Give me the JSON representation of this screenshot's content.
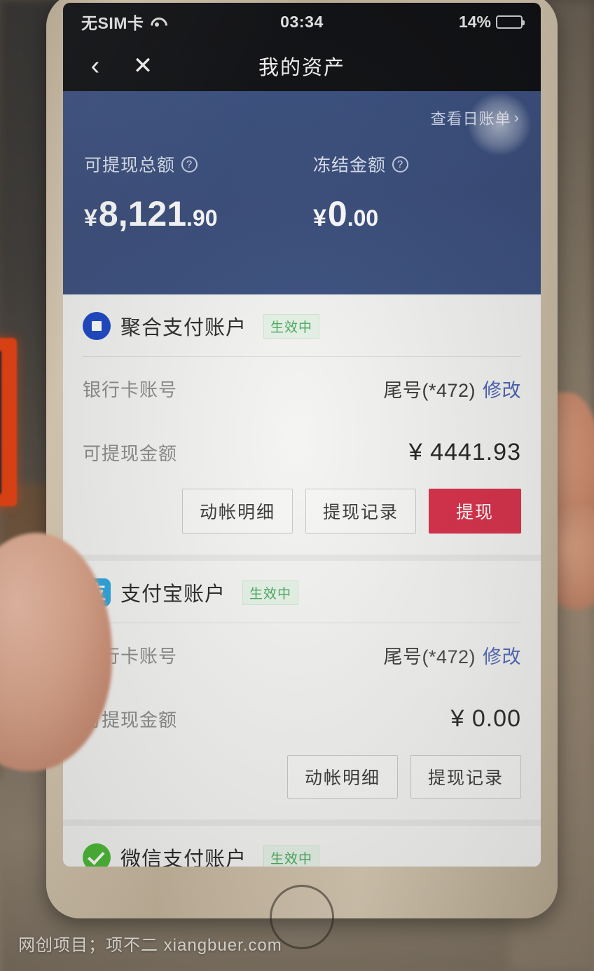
{
  "status_bar": {
    "carrier": "无SIM卡",
    "wifi_icon": "wifi-icon",
    "time": "03:34",
    "battery_percent": "14%",
    "battery_level": 14
  },
  "nav_bar": {
    "back_icon": "‹",
    "close_icon": "✕",
    "title": "我的资产"
  },
  "summary": {
    "daily_bill_link": "查看日账单",
    "chevron": "›",
    "withdrawable_total": {
      "label": "可提现总额",
      "help_icon": "?",
      "currency": "¥",
      "integer": "8,121",
      "decimal": ".90"
    },
    "frozen_amount": {
      "label": "冻结金额",
      "help_icon": "?",
      "currency": "¥",
      "integer": "0",
      "decimal": ".00"
    }
  },
  "accounts": [
    {
      "icon": "unionpay-icon",
      "title": "聚合支付账户",
      "status_badge": "生效中",
      "card_row_label": "银行卡账号",
      "card_row_value": "尾号(*472)",
      "card_row_action": "修改",
      "amount_label": "可提现金额",
      "amount_value": "¥ 4441.93",
      "buttons": [
        "动帐明细",
        "提现记录",
        "提现"
      ],
      "has_primary_button": true
    },
    {
      "icon": "alipay-icon",
      "title": "支付宝账户",
      "status_badge": "生效中",
      "card_row_label": "银行卡账号",
      "card_row_value": "尾号(*472)",
      "card_row_action": "修改",
      "amount_label": "可提现金额",
      "amount_value": "¥ 0.00",
      "buttons": [
        "动帐明细",
        "提现记录"
      ],
      "has_primary_button": false
    },
    {
      "icon": "wechatpay-icon",
      "title": "微信支付账户",
      "status_badge": "生效中"
    }
  ],
  "watermark": "网创项目；项不二 xiangbuer.com",
  "colors": {
    "header_blue": "#3a4e7c",
    "primary_red": "#d8304a",
    "badge_green": "#49a85e",
    "link_blue": "#4b63b5",
    "unionpay_blue": "#1b47c6",
    "alipay_blue": "#2ea7e0",
    "wechat_green": "#4dbb38"
  }
}
